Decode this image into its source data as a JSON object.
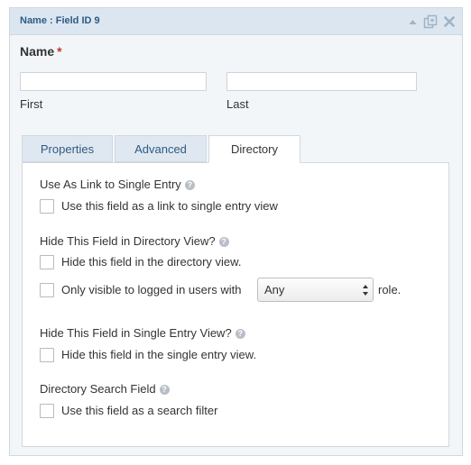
{
  "header": {
    "title": "Name : Field ID 9",
    "icons": [
      "collapse-arrow-icon",
      "duplicate-icon",
      "delete-icon"
    ]
  },
  "field": {
    "label": "Name",
    "required_mark": "*",
    "first_value": "",
    "first_label": "First",
    "last_value": "",
    "last_label": "Last"
  },
  "tabs": [
    {
      "label": "Properties",
      "active": false
    },
    {
      "label": "Advanced",
      "active": false
    },
    {
      "label": "Directory",
      "active": true
    }
  ],
  "directory": {
    "link_section": {
      "title": "Use As Link to Single Entry",
      "checkbox_label": "Use this field as a link to single entry view",
      "checked": false
    },
    "hide_directory_section": {
      "title": "Hide This Field in Directory View?",
      "checkbox_label": "Hide this field in the directory view.",
      "checked": false,
      "visible_label": "Only visible to logged in users with",
      "visible_checked": false,
      "role_value": "Any",
      "role_suffix": "role."
    },
    "hide_single_section": {
      "title": "Hide This Field in Single Entry View?",
      "checkbox_label": "Hide this field in the single entry view.",
      "checked": false
    },
    "search_section": {
      "title": "Directory Search Field",
      "checkbox_label": "Use this field as a search filter",
      "checked": false
    }
  },
  "colors": {
    "header_bg": "#dbe6f0",
    "title_blue": "#2e5b85",
    "required_red": "#c0392b"
  }
}
